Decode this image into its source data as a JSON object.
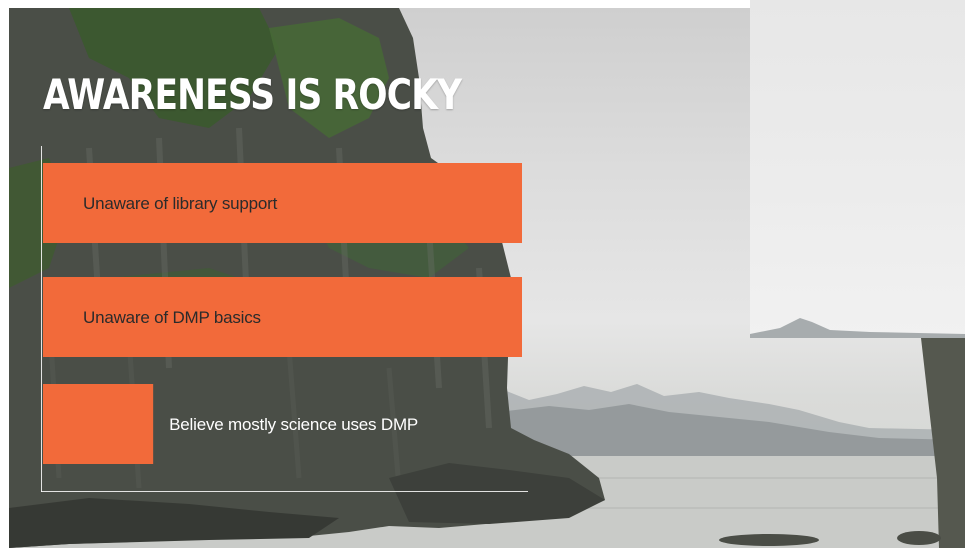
{
  "slide": {
    "title": "AWARENESS IS ROCKY"
  },
  "colors": {
    "bar": "#f26a3a",
    "label_on_bar": "#2b2b2b",
    "label_outside": "#ffffff",
    "title": "#ffffff"
  },
  "chart_data": {
    "type": "bar",
    "orientation": "horizontal",
    "title": "AWARENESS IS ROCKY",
    "xlabel": "",
    "ylabel": "",
    "categories": [
      "Unaware of library support",
      "Unaware of DMP basics",
      "Believe mostly science uses DMP"
    ],
    "values": [
      100,
      100,
      23
    ],
    "xlim": [
      0,
      100
    ],
    "grid": false,
    "legend": "none"
  }
}
